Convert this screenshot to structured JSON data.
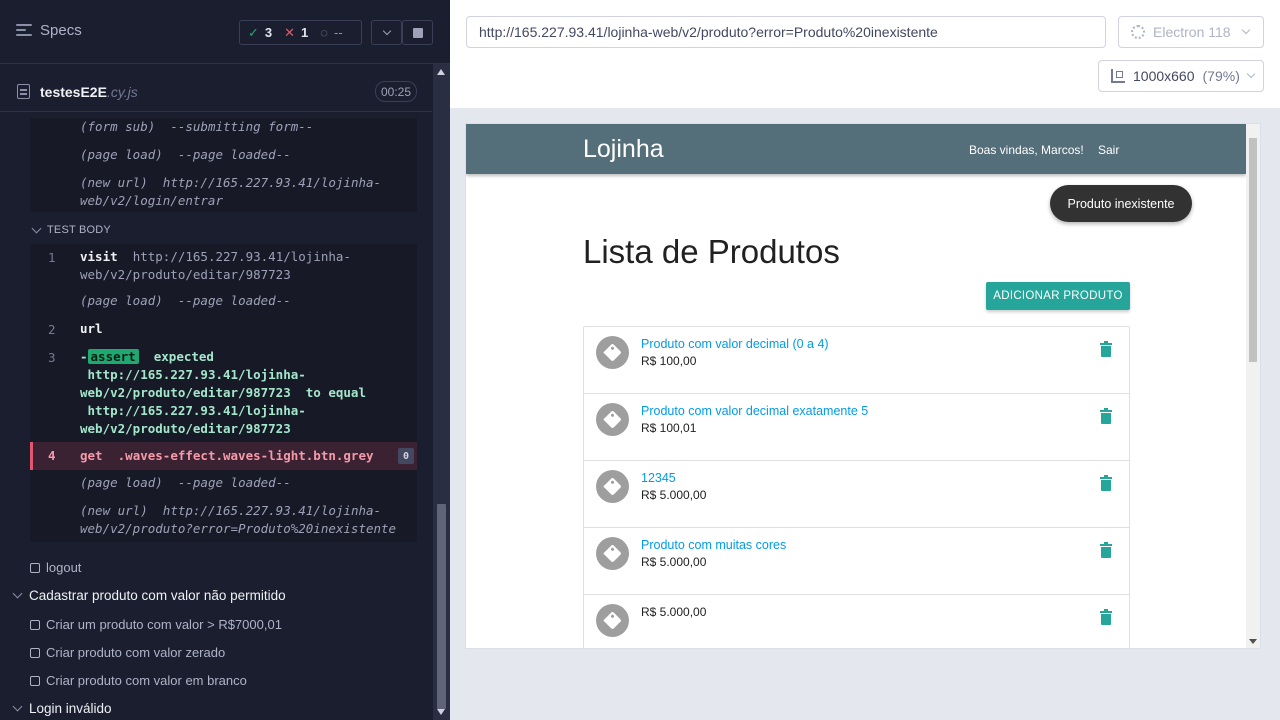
{
  "runner": {
    "specs_label": "Specs",
    "stats": {
      "passed": "3",
      "failed": "1",
      "pending": "--"
    },
    "file": {
      "name": "testesE2E",
      "ext": ".cy.js",
      "duration": "00:25"
    },
    "log_before": [
      {
        "kind": "(form sub)",
        "text": "--submitting form--"
      },
      {
        "kind": "(page load)",
        "text": "--page loaded--"
      },
      {
        "kind": "(new url)",
        "text_line1": "http://165.227.93.41/lojinha-",
        "text_line2": "web/v2/login/entrar"
      }
    ],
    "test_body_label": "TEST BODY",
    "commands": [
      {
        "num": "1",
        "name": "visit",
        "line1": "http://165.227.93.41/lojinha-",
        "line2": "web/v2/produto/editar/987723"
      },
      {
        "kind": "(page load)",
        "text": "--page loaded--"
      },
      {
        "num": "2",
        "name": "url"
      },
      {
        "num": "3",
        "dash": "-",
        "badge": "assert",
        "expected": "expected",
        "l1": "http://165.227.93.41/lojinha-",
        "l2": "web/v2/produto/editar/987723",
        "to_equal": "to equal",
        "l3": "http://165.227.93.41/lojinha-",
        "l4": "web/v2/produto/editar/987723"
      },
      {
        "num": "4",
        "name": "get",
        "selector": ".waves-effect.waves-light.btn.grey",
        "count": "0"
      },
      {
        "kind": "(page load)",
        "text": "--page loaded--"
      },
      {
        "kind": "(new url)",
        "line1": "http://165.227.93.41/lojinha-",
        "line2": "web/v2/produto?error=Produto%20inexistente"
      }
    ],
    "tests": {
      "logout": "logout",
      "suite1": "Cadastrar produto com valor não permitido",
      "t1": "Criar um produto com valor > R$7000,01",
      "t2": "Criar produto com valor zerado",
      "t3": "Criar produto com valor em branco",
      "suite2": "Login inválido"
    }
  },
  "aut": {
    "url": "http://165.227.93.41/lojinha-web/v2/produto?error=Produto%20inexistente",
    "browser": "Electron 118",
    "viewport": "1000x660",
    "zoom": "(79%)",
    "app": {
      "brand": "Lojinha",
      "welcome": "Boas vindas, Marcos!",
      "logout": "Sair",
      "toast": "Produto inexistente",
      "heading": "Lista de Produtos",
      "add_button": "ADICIONAR PRODUTO",
      "products": [
        {
          "title": "Produto com valor decimal (0 a 4)",
          "price": "R$ 100,00"
        },
        {
          "title": "Produto com valor decimal exatamente 5",
          "price": "R$ 100,01"
        },
        {
          "title": "12345",
          "price": "R$ 5.000,00"
        },
        {
          "title": "Produto com muitas cores",
          "price": "R$ 5.000,00"
        },
        {
          "title": "",
          "price": "R$ 5.000,00"
        }
      ]
    }
  },
  "colors": {
    "pass": "#1fa971",
    "fail": "#e45770",
    "teal": "#26a69a",
    "nav": "#546e7a",
    "link": "#039be5"
  }
}
